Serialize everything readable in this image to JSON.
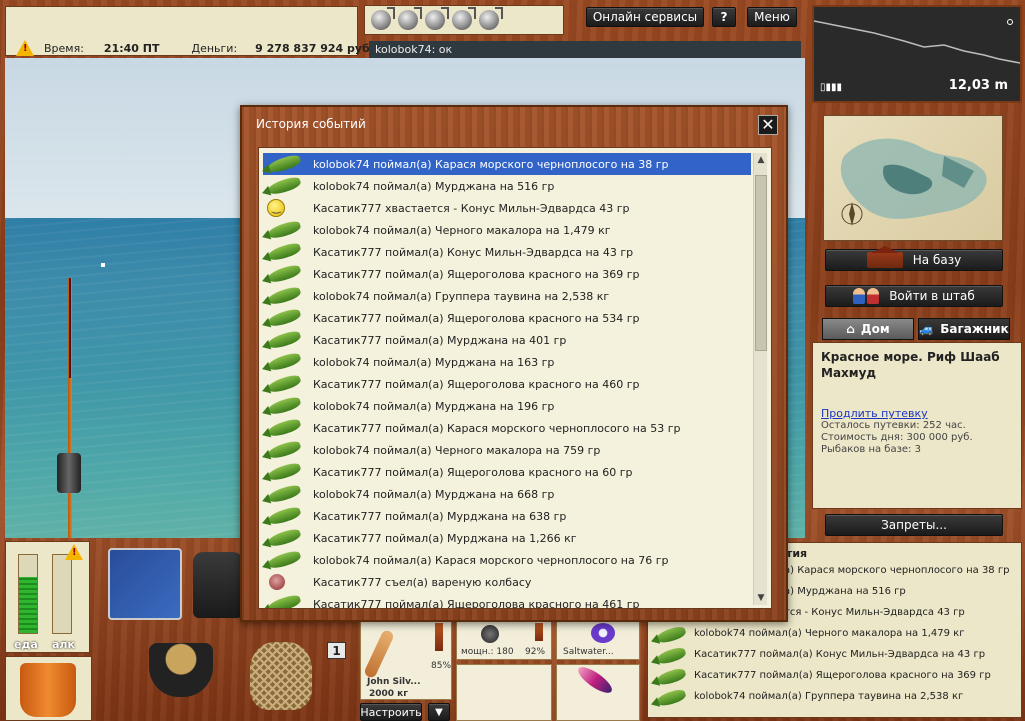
{
  "status": {
    "time_label": "Время:",
    "time_value": "21:40 ПТ",
    "money_label": "Деньги:",
    "money_value": "9 278 837 924 руб."
  },
  "chat": {
    "line": "kolobok74: ок"
  },
  "topbar": {
    "online_services": "Онлайн сервисы",
    "help": "?",
    "menu": "Меню"
  },
  "depth": {
    "value": "12,03 m"
  },
  "nav": {
    "to_base": "На базу",
    "to_hq": "Войти в штаб",
    "bans": "Запреты..."
  },
  "tabs": [
    {
      "label": "Дом",
      "icon": "house-icon"
    },
    {
      "label": "Багажник",
      "icon": "car-icon"
    }
  ],
  "location": {
    "title": "Красное море. Риф Шааб Махмуд",
    "extend_link": "Продлить путевку",
    "remaining": "Осталось путевки: 252 час.",
    "day_cost": "Стоимость дня: 300 000 руб.",
    "fishers": "Рыбаков на базе: 3"
  },
  "hunger": {
    "food_label": "еда",
    "alcohol_label": "алк",
    "food_level": 0.72,
    "alcohol_level": 0.0
  },
  "inventory": {
    "count_badge": "1"
  },
  "rodslot": {
    "reel_name": "John Silv...",
    "weight": "2000 кг",
    "durability": "85%",
    "power": "мощн.: 180",
    "power_pct": "92%",
    "line_name": "Saltwater...",
    "setup": "Настроить",
    "down": "▼"
  },
  "dialog": {
    "title": "История событий",
    "close": "✕",
    "selected_index": 0,
    "events": [
      {
        "icon": "fish",
        "text": "kolobok74 поймал(а) Карася морского черноплосого на 38 гр"
      },
      {
        "icon": "fish",
        "text": "kolobok74 поймал(а) Мурджана на 516 гр"
      },
      {
        "icon": "smile",
        "text": "Касатик777 хвастается - Конус Мильн-Эдвардса 43 гр"
      },
      {
        "icon": "fish",
        "text": "kolobok74 поймал(а) Черного макалора на 1,479 кг"
      },
      {
        "icon": "fish",
        "text": "Касатик777 поймал(а) Конус Мильн-Эдвардса на 43 гр"
      },
      {
        "icon": "fish",
        "text": "Касатик777 поймал(а) Ящероголова красного на 369 гр"
      },
      {
        "icon": "fish",
        "text": "kolobok74 поймал(а) Группера таувина на 2,538 кг"
      },
      {
        "icon": "fish",
        "text": "Касатик777 поймал(а) Ящероголова красного на 534 гр"
      },
      {
        "icon": "fish",
        "text": "Касатик777 поймал(а) Мурджана на 401 гр"
      },
      {
        "icon": "fish",
        "text": "kolobok74 поймал(а) Мурджана на 163 гр"
      },
      {
        "icon": "fish",
        "text": "Касатик777 поймал(а) Ящероголова красного на 460 гр"
      },
      {
        "icon": "fish",
        "text": "kolobok74 поймал(а) Мурджана на 196 гр"
      },
      {
        "icon": "fish",
        "text": "Касатик777 поймал(а) Карася морского черноплосого на 53 гр"
      },
      {
        "icon": "fish",
        "text": "kolobok74 поймал(а) Черного макалора на 759 гр"
      },
      {
        "icon": "fish",
        "text": "Касатик777 поймал(а) Ящероголова красного на 60 гр"
      },
      {
        "icon": "fish",
        "text": "kolobok74 поймал(а) Мурджана на 668 гр"
      },
      {
        "icon": "fish",
        "text": "Касатик777 поймал(а) Мурджана на 638 гр"
      },
      {
        "icon": "fish",
        "text": "Касатик777 поймал(а) Мурджана на 1,266 кг"
      },
      {
        "icon": "fish",
        "text": "kolobok74 поймал(а) Карася морского черноплосого на 76 гр"
      },
      {
        "icon": "sausage",
        "text": "Касатик777 съел(а) вареную колбасу"
      },
      {
        "icon": "fish",
        "text": "Касатик777 поймал(а) Ящероголова красного на 461 гр"
      }
    ]
  },
  "events_panel": {
    "header": "ытия",
    "items": [
      {
        "text": "а) Карася морского черноплосого на 38 гр",
        "icon": false
      },
      {
        "text": "а) Мурджана на 516 гр",
        "icon": false
      },
      {
        "text": "тся - Конус Мильн-Эдвардса 43 гр",
        "icon": false
      },
      {
        "text": "kolobok74 поймал(а) Черного макалора на 1,479 кг",
        "icon": true
      },
      {
        "text": "Касатик777 поймал(а) Конус Мильн-Эдвардса на 43 гр",
        "icon": true
      },
      {
        "text": "Касатик777 поймал(а) Ящероголова красного на 369 гр",
        "icon": true
      },
      {
        "text": "kolobok74 поймал(а) Группера таувина на 2,538 кг",
        "icon": true
      }
    ]
  },
  "colors": {
    "selection": "#3264c8",
    "panel_cream": "#f4f1dc",
    "link": "#1a35c0",
    "bar_green": "#2fb62f"
  }
}
